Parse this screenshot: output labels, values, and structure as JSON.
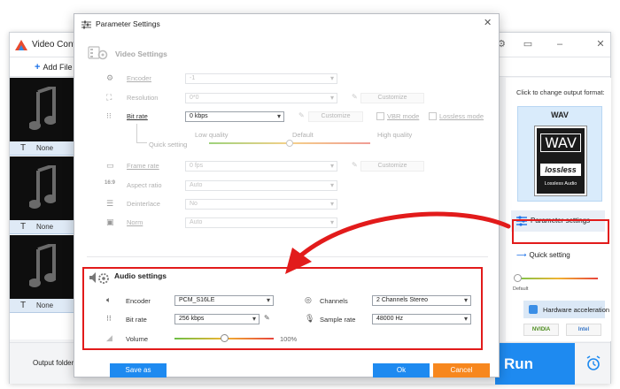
{
  "app": {
    "title": "Video Conv",
    "toolbar": {
      "add_files": "Add File"
    },
    "files": [
      {
        "subtitle": "None"
      },
      {
        "subtitle": "None"
      },
      {
        "subtitle": "None"
      }
    ],
    "right_panel": {
      "caption": "Click to change output format:",
      "format_name": "WAV",
      "format_logo_text": "WAV",
      "format_logo_brand": "lossless",
      "format_logo_sub": "Lossless Audio",
      "parameter_settings_label": "Parameter settings",
      "quick_setting_label": "Quick setting",
      "quick_default_label": "Default",
      "hardware_accel_label": "Hardware acceleration",
      "vendors": [
        "NVIDIA",
        "Intel"
      ]
    },
    "bottom": {
      "output_folder_label": "Output folder:",
      "run_label": "Run"
    }
  },
  "dialog": {
    "title": "Parameter Settings",
    "video": {
      "section_title": "Video Settings",
      "encoder": {
        "label": "Encoder",
        "value": "-1"
      },
      "resolution": {
        "label": "Resolution",
        "value": "0*0",
        "customize": "Customize"
      },
      "bitrate": {
        "label": "Bit rate",
        "value": "0 kbps",
        "customize": "Customize",
        "vbr_mode": "VBR mode",
        "lossless_mode": "Lossless mode"
      },
      "quick": {
        "label": "Quick setting",
        "low": "Low quality",
        "default": "Default",
        "high": "High quality",
        "level": 0.5
      },
      "framerate": {
        "label": "Frame rate",
        "value": "0 fps",
        "customize": "Customize"
      },
      "aspect": {
        "label": "Aspect ratio",
        "value": "Auto"
      },
      "deinterlace": {
        "label": "Deinterlace",
        "value": "No"
      },
      "norm": {
        "label": "Norm",
        "value": "Auto"
      }
    },
    "audio": {
      "section_title": "Audio settings",
      "encoder": {
        "label": "Encoder",
        "value": "PCM_S16LE"
      },
      "channels": {
        "label": "Channels",
        "value": "2 Channels Stereo"
      },
      "bitrate": {
        "label": "Bit rate",
        "value": "256 kbps"
      },
      "samplerate": {
        "label": "Sample rate",
        "value": "48000 Hz"
      },
      "volume": {
        "label": "Volume",
        "value_text": "100%",
        "level": 0.5
      }
    },
    "footer": {
      "save_as": "Save as",
      "ok": "Ok",
      "cancel": "Cancel"
    }
  },
  "colors": {
    "accent": "#1e8af0",
    "ok": "#1e8af0",
    "cancel": "#f7871e",
    "highlight": "#e21b1b"
  }
}
